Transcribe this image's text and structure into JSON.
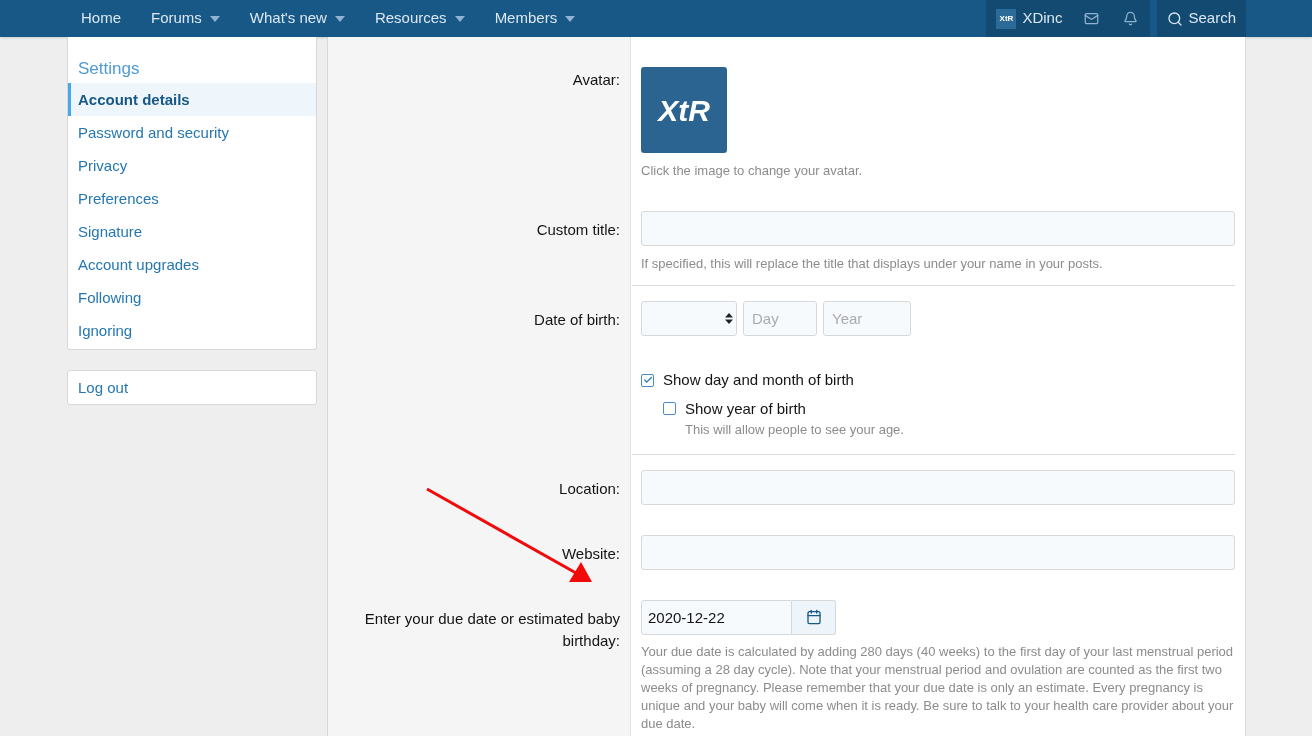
{
  "nav": {
    "items": [
      {
        "label": "Home",
        "has_menu": false
      },
      {
        "label": "Forums",
        "has_menu": true
      },
      {
        "label": "What's new",
        "has_menu": true
      },
      {
        "label": "Resources",
        "has_menu": true
      },
      {
        "label": "Members",
        "has_menu": true
      }
    ],
    "account": "XDinc",
    "account_logo": "XtR",
    "search": "Search"
  },
  "sidebar": {
    "title": "Settings",
    "items": [
      {
        "label": "Account details",
        "selected": true
      },
      {
        "label": "Password and security",
        "selected": false
      },
      {
        "label": "Privacy",
        "selected": false
      },
      {
        "label": "Preferences",
        "selected": false
      },
      {
        "label": "Signature",
        "selected": false
      },
      {
        "label": "Account upgrades",
        "selected": false
      },
      {
        "label": "Following",
        "selected": false
      },
      {
        "label": "Ignoring",
        "selected": false
      }
    ],
    "logout": "Log out"
  },
  "form": {
    "avatar": {
      "label": "Avatar:",
      "logo": "XtR",
      "hint": "Click the image to change your avatar."
    },
    "custom_title": {
      "label": "Custom title:",
      "hint": "If specified, this will replace the title that displays under your name in your posts."
    },
    "birth": {
      "label": "Date of birth:",
      "day_placeholder": "Day",
      "year_placeholder": "Year",
      "options": [
        {
          "label": "Show day and month of birth",
          "checked": true
        },
        {
          "label": "Show year of birth",
          "checked": false,
          "hint": "This will allow people to see your age."
        }
      ]
    },
    "location": {
      "label": "Location:"
    },
    "website": {
      "label": "Website:"
    },
    "due_date": {
      "label": "Enter your due date or estimated baby birthday:",
      "value": "2020-12-22",
      "hint": "Your due date is calculated by adding 280 days (40 weeks) to the first day of your last menstrual period (assuming a 28 day cycle). Note that your menstrual period and ovulation are counted as the first two weeks of pregnancy. Please remember that your due date is only an estimate. Every pregnancy is unique and your baby will come when it is ready. Be sure to talk to your health care provider about your due date."
    }
  }
}
